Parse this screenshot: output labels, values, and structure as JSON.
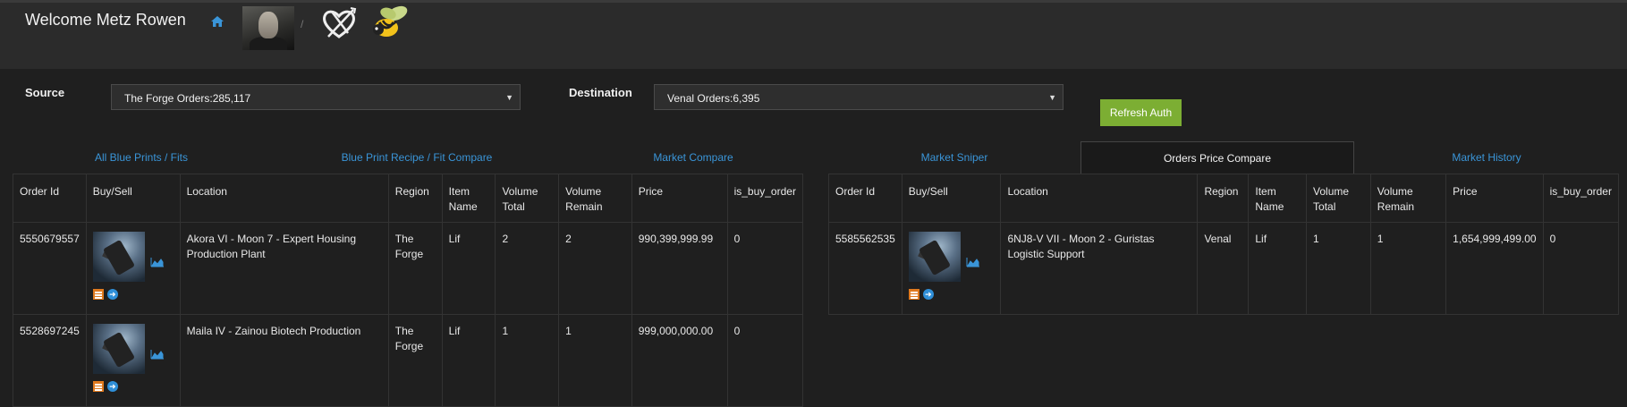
{
  "header": {
    "welcome": "Welcome Metz Rowen",
    "separator": "/"
  },
  "source": {
    "label": "Source",
    "value": "The Forge Orders:285,117"
  },
  "destination": {
    "label": "Destination",
    "value": "Venal Orders:6,395"
  },
  "refresh_label": "Refresh Auth",
  "tabs": [
    {
      "label": "All Blue Prints / Fits"
    },
    {
      "label": "Blue Print Recipe / Fit Compare"
    },
    {
      "label": "Market Compare"
    },
    {
      "label": "Market Sniper"
    },
    {
      "label": "Orders Price Compare"
    },
    {
      "label": "Market History"
    }
  ],
  "active_tab": "Orders Price Compare",
  "columns": {
    "order_id": "Order Id",
    "buy_sell": "Buy/Sell",
    "location": "Location",
    "region": "Region",
    "item_name": "Item Name",
    "volume_total": "Volume Total",
    "volume_remain": "Volume Remain",
    "price": "Price",
    "is_buy_order": "is_buy_order"
  },
  "source_orders": [
    {
      "order_id": "5550679557",
      "location": "Akora VI - Moon 7 - Expert Housing Production Plant",
      "region": "The Forge",
      "item_name": "Lif",
      "volume_total": "2",
      "volume_remain": "2",
      "price": "990,399,999.99",
      "is_buy_order": "0"
    },
    {
      "order_id": "5528697245",
      "location": "Maila IV - Zainou Biotech Production",
      "region": "The Forge",
      "item_name": "Lif",
      "volume_total": "1",
      "volume_remain": "1",
      "price": "999,000,000.00",
      "is_buy_order": "0"
    }
  ],
  "destination_orders": [
    {
      "order_id": "5585562535",
      "location": "6NJ8-V VII - Moon 2 - Guristas Logistic Support",
      "region": "Venal",
      "item_name": "Lif",
      "volume_total": "1",
      "volume_remain": "1",
      "price": "1,654,999,499.00",
      "is_buy_order": "0"
    }
  ],
  "colors": {
    "accent_link": "#3a95d8",
    "button_green": "#7cae33",
    "icon_orange": "#e07a1f"
  },
  "icons": [
    "home-icon",
    "heart-swords-icon",
    "bee-icon",
    "market-chart-icon",
    "list-icon",
    "arrow-circle-icon"
  ]
}
